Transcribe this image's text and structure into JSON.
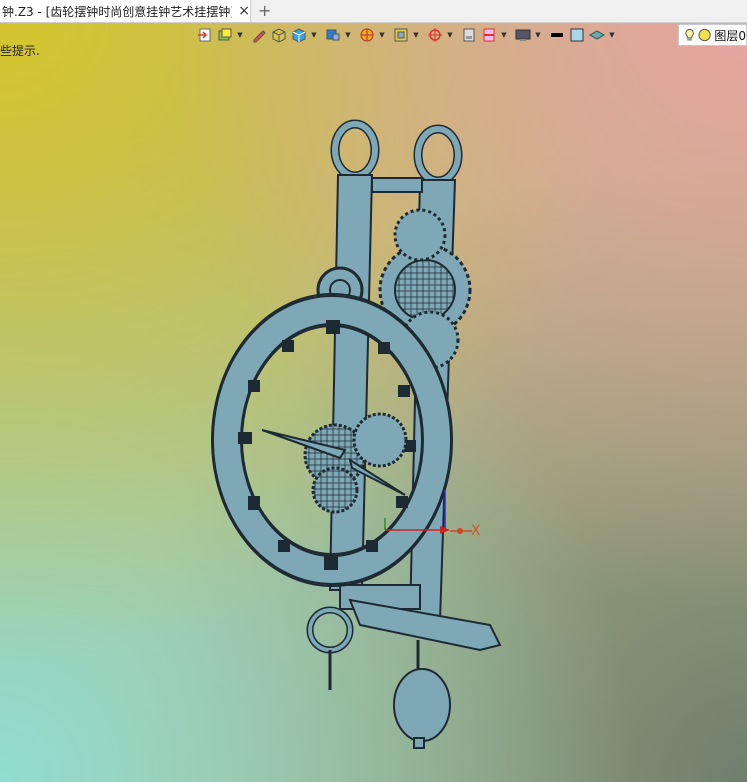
{
  "tab": {
    "title": "钟.Z3 - [齿轮摆钟时尚创意挂钟艺术挂摆钟]",
    "close": "×",
    "add": "+"
  },
  "hint": "些提示.",
  "toolbar": {
    "icons": [
      "import-icon",
      "layers-icon",
      "pencil-icon",
      "solid-box-icon",
      "cube-icon",
      "view-cube-icon",
      "render-mode-icon",
      "frame-icon",
      "snap-target-icon",
      "sheet-icon",
      "section-icon",
      "display-icon",
      "line-color-icon",
      "face-color-icon",
      "material-icon"
    ]
  },
  "layer": {
    "label": "图层0"
  },
  "axis": {
    "x_label": "X"
  },
  "colors": {
    "model": "#7fa8b6",
    "edge": "#1d2a33",
    "accent_red": "#cc2222"
  }
}
